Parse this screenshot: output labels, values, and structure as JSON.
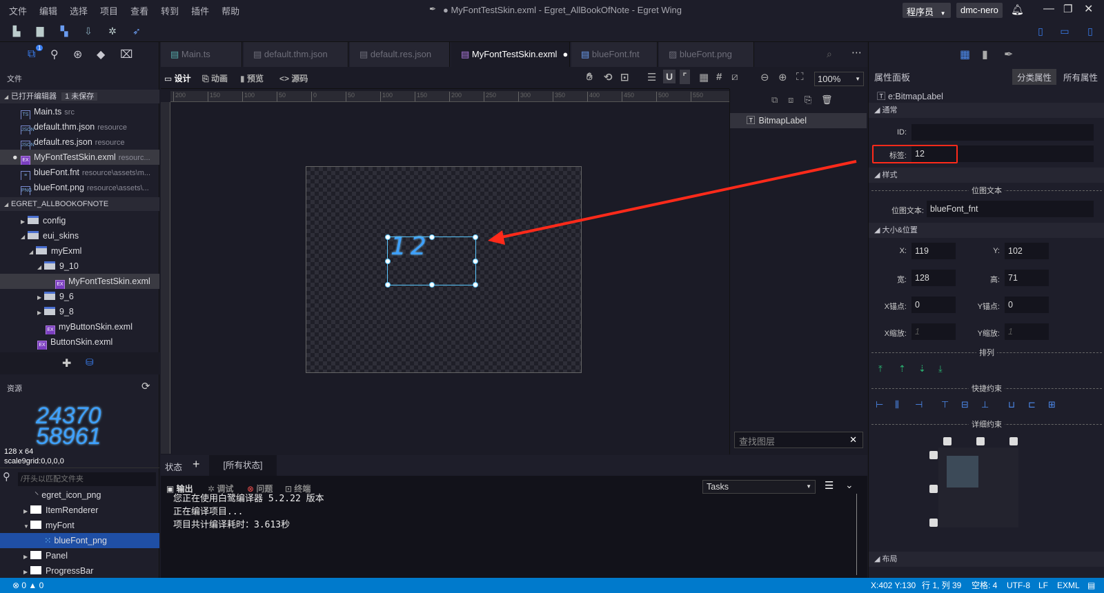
{
  "menu": [
    "文件",
    "编辑",
    "选择",
    "项目",
    "查看",
    "转到",
    "插件",
    "帮助"
  ],
  "title": "● MyFontTestSkin.exml - Egret_AllBookOfNote - Egret Wing",
  "role": "程序员",
  "user": "dmc-nero",
  "left": {
    "notification_badge": "1",
    "files_header": "文件",
    "open_editors": "已打开编辑器",
    "unsaved_badge": "1 未保存",
    "open_files": [
      {
        "name": "Main.ts",
        "path": "src",
        "icon": "TS"
      },
      {
        "name": "default.thm.json",
        "path": "resource",
        "icon": "JSON"
      },
      {
        "name": "default.res.json",
        "path": "resource",
        "icon": "JSON"
      },
      {
        "name": "MyFontTestSkin.exml",
        "path": "resourc...",
        "icon": "EX"
      },
      {
        "name": "blueFont.fnt",
        "path": "resource\\assets\\m...",
        "icon": "≡"
      },
      {
        "name": "blueFont.png",
        "path": "resource\\assets\\...",
        "icon": "PNG"
      }
    ],
    "project": "EGRET_ALLBOOKOFNOTE",
    "tree": [
      "config",
      "eui_skins",
      "myExml",
      "9_10",
      "MyFontTestSkin.exml",
      "9_6",
      "9_8",
      "myButtonSkin.exml",
      "ButtonSkin.exml"
    ],
    "resources_header": "资源",
    "preview_text_line1": "24370",
    "preview_text_line2": "58961",
    "preview_size": "128 x 64",
    "preview_scale9": "scale9grid:0,0,0,0",
    "search_placeholder": "/开头以匹配文件夹",
    "res_tree": [
      "egret_icon_png",
      "ItemRenderer",
      "myFont",
      "blueFont_png",
      "Panel",
      "ProgressBar"
    ]
  },
  "tabs": [
    "Main.ts",
    "default.thm.json",
    "default.res.json",
    "MyFontTestSkin.exml",
    "blueFont.fnt",
    "blueFont.png"
  ],
  "active_tab": "MyFontTestSkin.exml",
  "modes": [
    "设计",
    "动画",
    "预览",
    "源码"
  ],
  "zoom": "100%",
  "ruler": [
    "200",
    "150",
    "100",
    "50",
    "0",
    "50",
    "100",
    "150",
    "200",
    "250",
    "300",
    "350",
    "400",
    "450",
    "500",
    "550"
  ],
  "canvas_text": "12",
  "layers": {
    "item": "BitmapLabel",
    "search_placeholder": "查找图层"
  },
  "props": {
    "title": "属性面板",
    "tab_category": "分类属性",
    "tab_all": "所有属性",
    "component": "e:BitmapLabel",
    "sec_general": "通常",
    "id_label": "ID:",
    "id_value": "",
    "tag_label": "标签:",
    "tag_value": "12",
    "sec_style": "样式",
    "bitmap_group": "位图文本",
    "font_label": "位图文本:",
    "font_value": "blueFont_fnt",
    "sec_size": "大小&位置",
    "x_label": "X:",
    "x": "119",
    "y_label": "Y:",
    "y": "102",
    "w_label": "宽:",
    "w": "128",
    "h_label": "高:",
    "h": "71",
    "ax_label": "X锚点:",
    "ax": "0",
    "ay_label": "Y锚点:",
    "ay": "0",
    "sx_label": "X缩放:",
    "sx": "1",
    "sy_label": "Y缩放:",
    "sy": "1",
    "arrange": "排列",
    "quick": "快捷约束",
    "detail": "详细约束",
    "sec_layout": "布局"
  },
  "states": {
    "label": "状态",
    "add": "+",
    "all": "[所有状态]"
  },
  "output": {
    "tabs": [
      "输出",
      "调试",
      "问题",
      "终端"
    ],
    "select": "Tasks",
    "lines": [
      "您正在使用白鹭编译器 5.2.22 版本",
      "正在编译项目...",
      "项目共计编译耗时：3.613秒"
    ]
  },
  "status": {
    "errors": "0",
    "warnings": "0",
    "cursor": "X:402 Y:130",
    "position": "行 1, 列 39",
    "indent": "空格: 4",
    "encoding": "UTF-8",
    "eol": "LF",
    "lang": "EXML"
  },
  "colors": {
    "accent": "#007acc",
    "selection": "#5cc8ff",
    "annotation": "#ff2a1a",
    "bitmap_font": "#3ea0ff"
  }
}
